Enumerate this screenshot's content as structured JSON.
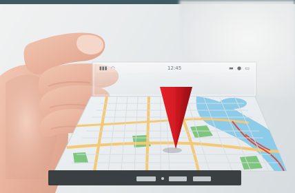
{
  "status_bar": {
    "time": "12:45",
    "signal_icon": "signal-icon",
    "audio_icon": "headphones-icon",
    "battery_icon": "battery-icon",
    "lock_icon": "lock-icon"
  },
  "bottom_controls": {
    "left_icon": "speaker-icon",
    "center_icon": "dot-icon",
    "right_icon": "rectangle-icon"
  },
  "map": {
    "marker_icon": "location-pin-icon",
    "marker_color": "#c8161d",
    "water_color": "#7ec6e6",
    "park_color": "#6ec06b",
    "land_color": "#e8ecf0",
    "road_color": "#f2c56a"
  }
}
